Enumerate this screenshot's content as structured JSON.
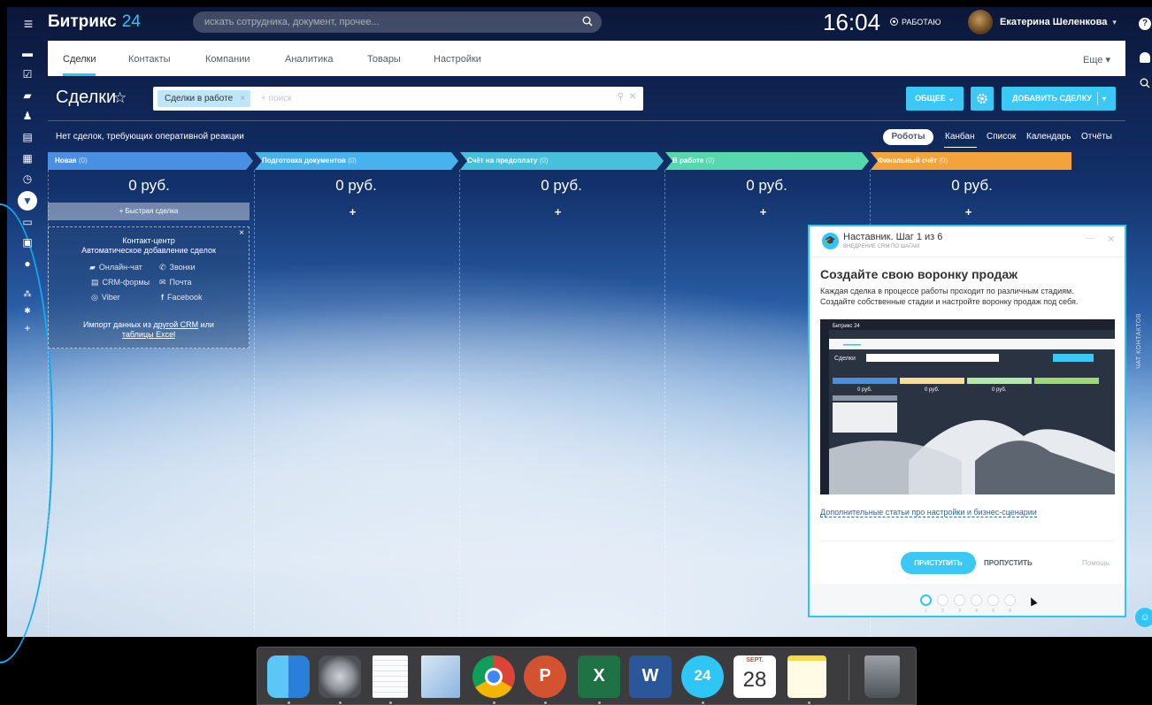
{
  "app": {
    "logo_main": "Битрикс",
    "logo_num": "24"
  },
  "topbar": {
    "search_placeholder": "искать сотрудника, документ, прочее...",
    "clock": "16:04",
    "work_status": "РАБОТАЮ",
    "username": "Екатерина Шеленкова",
    "username_caret": "▾"
  },
  "nav": {
    "tabs": [
      "Сделки",
      "Контакты",
      "Компании",
      "Аналитика",
      "Товары",
      "Настройки"
    ],
    "more": "Еще ▾"
  },
  "page": {
    "title": "Сделки",
    "star": "☆",
    "filter_chip": "Сделки в работе",
    "filter_placeholder": "+ поиск",
    "general_btn": "ОБЩЕЕ",
    "add_deal_btn": "ДОБАВИТЬ СДЕЛКУ",
    "notice": "Нет сделок, требующих оперативной реакции",
    "robots": "Роботы",
    "views": [
      "Канбан",
      "Список",
      "Календарь",
      "Отчёты"
    ]
  },
  "kanban": {
    "columns": [
      {
        "name": "Новая",
        "count": "(0)",
        "sum": "0 руб.",
        "color": "#4a90e2"
      },
      {
        "name": "Подготовка документов",
        "count": "(0)",
        "sum": "0 руб.",
        "color": "#47b2ee"
      },
      {
        "name": "Счёт на предоплату",
        "count": "(0)",
        "sum": "0 руб.",
        "color": "#48c0dc"
      },
      {
        "name": "В работе",
        "count": "(0)",
        "sum": "0 руб.",
        "color": "#56d7ad"
      },
      {
        "name": "Финальный счёт",
        "count": "(0)",
        "sum": "0 руб.",
        "color": "#f2a43a"
      }
    ],
    "plus": "+",
    "quick_deal": "+ Быстрая сделка"
  },
  "contact_center": {
    "title": "Контакт-центр",
    "subtitle": "Автоматическое добавление сделок",
    "channels": [
      "Онлайн-чат",
      "Звонки",
      "CRM-формы",
      "Почта",
      "Viber",
      "Facebook"
    ],
    "import_text": "Импорт данных из",
    "import_link1": "другой CRM",
    "import_or": "или",
    "import_link2": "таблицы Excel",
    "close": "×"
  },
  "mentor": {
    "step": "Наставник. Шаг 1 из 6",
    "step_sub": "ВНЕДРЕНИЕ CRM ПО ШАГАМ",
    "heading": "Создайте свою воронку продаж",
    "desc_line1": "Каждая сделка в процессе работы проходит по различным стадиям.",
    "desc_line2": "Создайте собственные стадии и настройте воронку продаж под себя.",
    "link": "Дополнительные статьи про настройки и бизнес-сценарии",
    "start_btn": "ПРИСТУПИТЬ",
    "skip_btn": "ПРОПУСТИТЬ",
    "help": "Помощь",
    "pages": [
      "1",
      "2",
      "3",
      "4",
      "5",
      "6"
    ],
    "current_page": 1,
    "preview": {
      "logo": "Битрикс 24",
      "title": "Сделки",
      "sum": "0 руб."
    }
  },
  "right_sidebar": {
    "help_icon": "?",
    "vertical_label": "ЧАТ КОНТАКТОВ"
  },
  "dock": {
    "apps": [
      "finder-icon",
      "system-preferences-icon",
      "textedit-icon",
      "mail-icon",
      "chrome-icon",
      "powerpoint-icon",
      "excel-icon",
      "word-icon",
      "bitrix24-icon",
      "calendar-icon",
      "notes-icon",
      "trash-icon"
    ],
    "calendar_month": "SEPT.",
    "calendar_day": "28",
    "bitrix_label": "24",
    "ppt_label": "P",
    "excel_label": "X",
    "word_label": "W"
  }
}
